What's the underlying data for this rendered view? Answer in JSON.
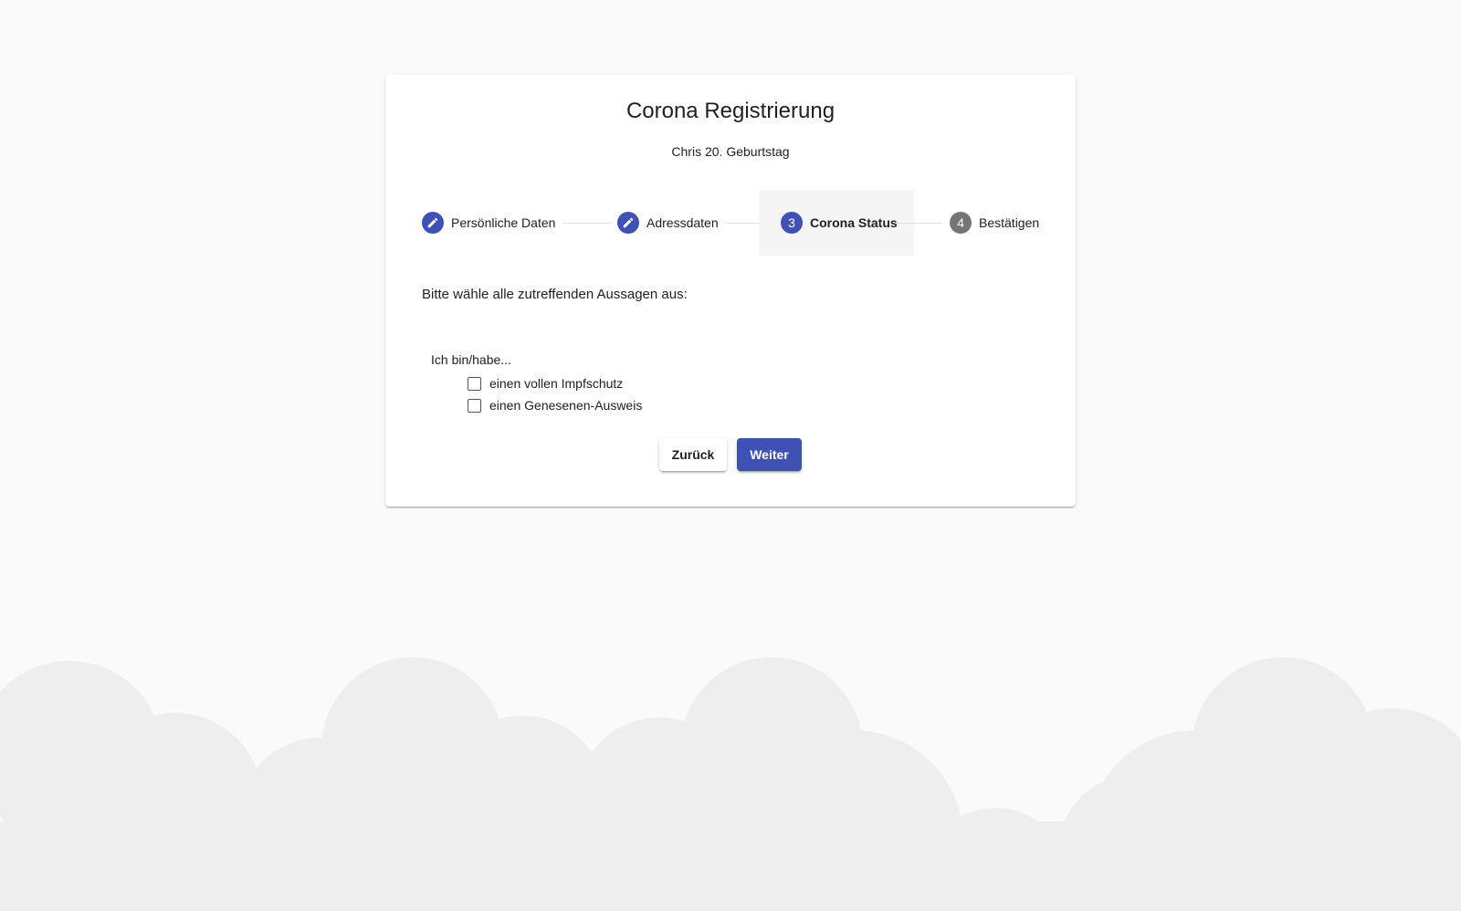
{
  "form": {
    "title": "Corona Registrierung",
    "subtitle": "Chris 20. Geburtstag",
    "prompt": "Bitte wähle alle zutreffenden Aussagen aus:",
    "group_label": "Ich bin/habe...",
    "options": [
      {
        "label": "einen vollen Impfschutz",
        "checked": false
      },
      {
        "label": "einen Genesenen-Ausweis",
        "checked": false
      }
    ]
  },
  "stepper": {
    "steps": [
      {
        "label": "Persönliche Daten",
        "state": "edit",
        "icon": "pencil-icon"
      },
      {
        "label": "Adressdaten",
        "state": "edit",
        "icon": "pencil-icon"
      },
      {
        "label": "Corona Status",
        "state": "active",
        "number": "3"
      },
      {
        "label": "Bestätigen",
        "state": "pending",
        "number": "4"
      }
    ]
  },
  "buttons": {
    "back_label": "Zurück",
    "next_label": "Weiter"
  },
  "colors": {
    "primary": "#3f51b5",
    "pending": "#757575",
    "background": "#fafafa",
    "cloud": "#eeeeee"
  }
}
